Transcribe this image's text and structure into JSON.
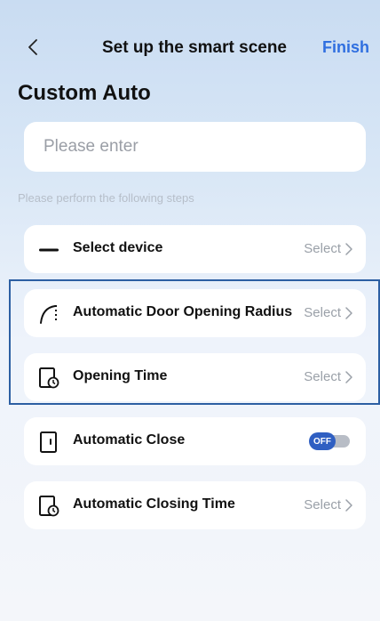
{
  "header": {
    "back_icon": "chevron-left-icon",
    "title": "Set up the smart scene",
    "finish_label": "Finish"
  },
  "heading": "Custom Auto",
  "name_input": {
    "placeholder": "Please enter",
    "value": ""
  },
  "hint": "Please perform the following steps",
  "steps": {
    "device": {
      "icon": "line-device-icon",
      "label": "Select device",
      "action": "Select"
    },
    "radius": {
      "icon": "door-radius-icon",
      "label": "Automatic Door Opening Radius",
      "action": "Select"
    },
    "opening_time": {
      "icon": "door-clock-icon",
      "label": "Opening Time",
      "action": "Select"
    },
    "auto_close": {
      "icon": "door-panel-icon",
      "label": "Automatic Close",
      "toggle_label": "OFF",
      "toggle_on": false
    },
    "closing_time": {
      "icon": "door-clock-icon",
      "label": "Automatic Closing Time",
      "action": "Select"
    }
  },
  "colors": {
    "accent": "#2f6fe0",
    "toggle_knob": "#2f5fc2",
    "highlight_border": "#2c5fa3"
  }
}
